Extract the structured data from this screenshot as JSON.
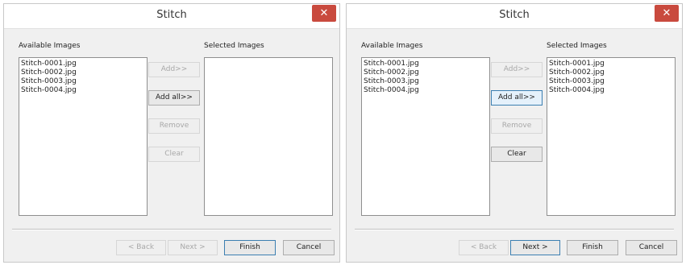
{
  "dialogs": [
    {
      "title": "Stitch",
      "close_label": "✕",
      "available_label": "Available Images",
      "selected_label": "Selected Images",
      "available_items": [
        "Stitch-0001.jpg",
        "Stitch-0002.jpg",
        "Stitch-0003.jpg",
        "Stitch-0004.jpg"
      ],
      "selected_items": [],
      "buttons": {
        "add": "Add>>",
        "add_all": "Add all>>",
        "remove": "Remove",
        "clear": "Clear",
        "back": "< Back",
        "next": "Next >",
        "finish": "Finish",
        "cancel": "Cancel"
      }
    },
    {
      "title": "Stitch",
      "close_label": "✕",
      "available_label": "Available Images",
      "selected_label": "Selected Images",
      "available_items": [
        "Stitch-0001.jpg",
        "Stitch-0002.jpg",
        "Stitch-0003.jpg",
        "Stitch-0004.jpg"
      ],
      "selected_items": [
        "Stitch-0001.jpg",
        "Stitch-0002.jpg",
        "Stitch-0003.jpg",
        "Stitch-0004.jpg"
      ],
      "buttons": {
        "add": "Add>>",
        "add_all": "Add all>>",
        "remove": "Remove",
        "clear": "Clear",
        "back": "< Back",
        "next": "Next >",
        "finish": "Finish",
        "cancel": "Cancel"
      }
    }
  ]
}
